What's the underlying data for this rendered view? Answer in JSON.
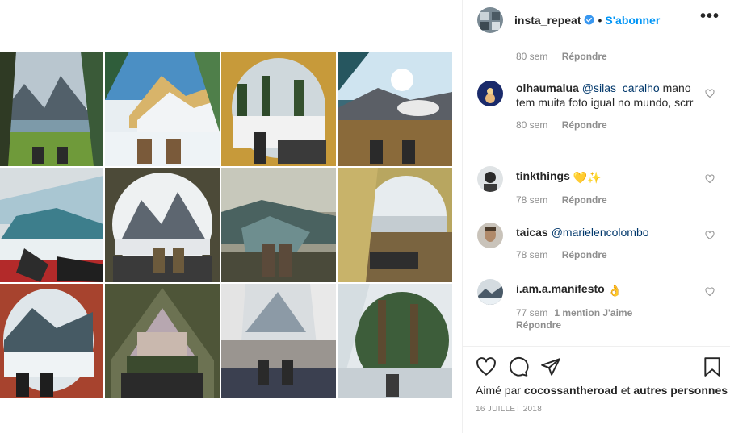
{
  "post": {
    "username": "insta_repeat",
    "separator": "•",
    "follow_label": "S'abonner",
    "more_label": "•••"
  },
  "comments": [
    {
      "username": "",
      "text": "",
      "time": "80 sem",
      "reply": "Répondre"
    },
    {
      "username": "olhaumalua",
      "mention": "@silas_caralho",
      "text": " mano tem muita foto igual no mundo, scrr",
      "time": "80 sem",
      "reply": "Répondre"
    },
    {
      "username": "tinkthings",
      "emoji": "💛✨",
      "time": "78 sem",
      "reply": "Répondre"
    },
    {
      "username": "taicas",
      "mention": "@marielencolombo",
      "time": "78 sem",
      "reply": "Répondre"
    },
    {
      "username": "i.am.a.manifesto",
      "emoji": "👌",
      "time": "77 sem",
      "likes": "1 mention J'aime",
      "reply": "Répondre"
    }
  ],
  "footer": {
    "liked_prefix": "Aimé par",
    "liked_user": "cocossantheroad",
    "liked_connector": "et",
    "liked_others": "autres personnes",
    "date": "16 JUILLET 2018"
  },
  "icons": {
    "like": "heart-icon",
    "comment": "comment-icon",
    "share": "share-icon",
    "save": "bookmark-icon",
    "verified": "verified-badge-icon"
  },
  "colors": {
    "accent": "#0095f6",
    "mention": "#00376b",
    "muted": "#8e8e8e"
  }
}
